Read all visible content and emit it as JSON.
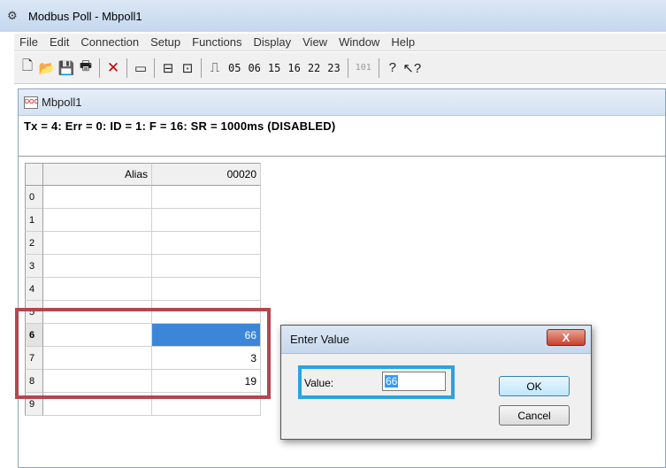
{
  "window": {
    "title": "Modbus Poll - Mbpoll1",
    "icon": "modbus-app-icon"
  },
  "menu": [
    "File",
    "Edit",
    "Connection",
    "Setup",
    "Functions",
    "Display",
    "View",
    "Window",
    "Help"
  ],
  "toolbar": {
    "function_codes": [
      "05",
      "06",
      "15",
      "16",
      "22",
      "23"
    ],
    "address_label": "101",
    "pulse_glyph": "⎍"
  },
  "child_window": {
    "title": "Mbpoll1",
    "status": "Tx = 4: Err = 0: ID = 1: F = 16: SR = 1000ms  (DISABLED)"
  },
  "grid": {
    "headers": {
      "alias": "Alias",
      "address": "00020"
    },
    "rows": [
      {
        "index": "0",
        "alias": "",
        "value": ""
      },
      {
        "index": "1",
        "alias": "",
        "value": ""
      },
      {
        "index": "2",
        "alias": "",
        "value": ""
      },
      {
        "index": "3",
        "alias": "",
        "value": ""
      },
      {
        "index": "4",
        "alias": "",
        "value": ""
      },
      {
        "index": "5",
        "alias": "",
        "value": ""
      },
      {
        "index": "6",
        "alias": "",
        "value": "66"
      },
      {
        "index": "7",
        "alias": "",
        "value": "3"
      },
      {
        "index": "8",
        "alias": "",
        "value": "19"
      },
      {
        "index": "9",
        "alias": "",
        "value": ""
      }
    ],
    "selected_row": 6
  },
  "dialog": {
    "title": "Enter Value",
    "close_label": "X",
    "value_label": "Value:",
    "value": "66",
    "ok_label": "OK",
    "cancel_label": "Cancel"
  },
  "colors": {
    "selection": "#3b86d8",
    "highlight_red": "#b5464f",
    "highlight_blue": "#2aa3e1"
  }
}
